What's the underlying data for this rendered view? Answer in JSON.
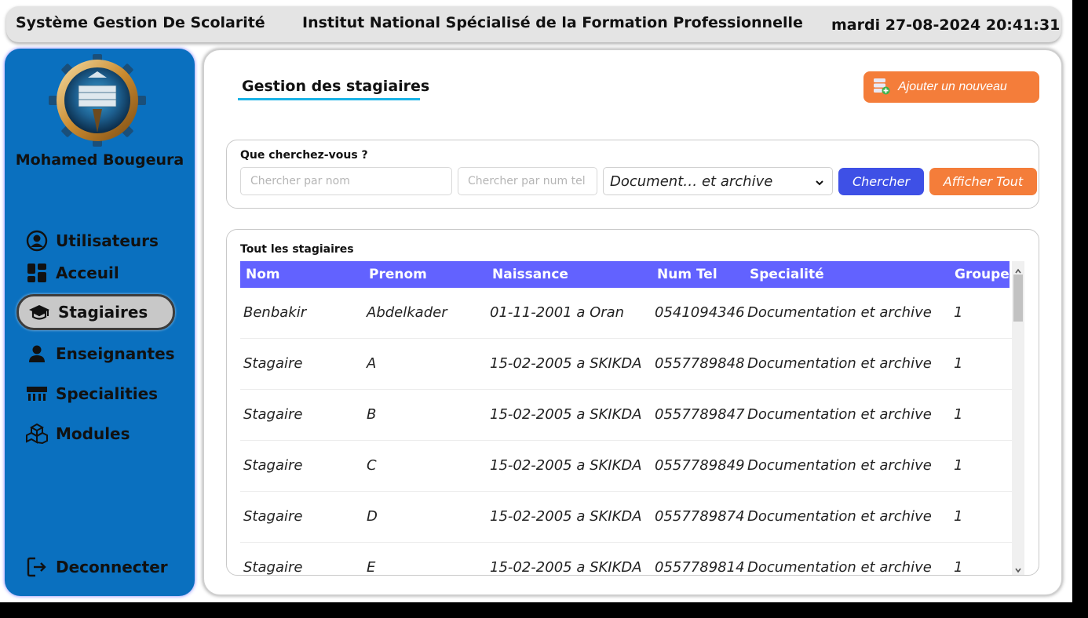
{
  "header": {
    "app_title": "Système Gestion De Scolarité",
    "institution": "Institut National Spécialisé de la Formation Professionnelle",
    "datetime": "mardi 27-08-2024 20:41:31"
  },
  "sidebar": {
    "username": "Mohamed Bougeura",
    "items": [
      {
        "label": "Utilisateurs",
        "icon": "user-circle-icon"
      },
      {
        "label": "Acceuil",
        "icon": "dashboard-icon"
      },
      {
        "label": "Stagiaires",
        "icon": "graduation-cap-icon",
        "active": true
      },
      {
        "label": "Enseignantes",
        "icon": "person-icon"
      },
      {
        "label": "Specialities",
        "icon": "classroom-icon"
      },
      {
        "label": "Modules",
        "icon": "cubes-icon"
      }
    ],
    "logout": {
      "label": "Deconnecter",
      "icon": "logout-icon"
    }
  },
  "main": {
    "title": "Gestion des stagiaires",
    "add_button": "Ajouter un nouveau",
    "search": {
      "label": "Que cherchez-vous ?",
      "name_placeholder": "Chercher par nom",
      "tel_placeholder": "Chercher par num tel",
      "specialty_selected": "Document… et archive",
      "search_button": "Chercher",
      "show_all_button": "Afficher Tout"
    },
    "table": {
      "label": "Tout les stagiaires",
      "columns": [
        "Nom",
        "Prenom",
        "Naissance",
        "Num Tel",
        "Specialité",
        "Groupe"
      ],
      "rows": [
        [
          "Benbakir",
          "Abdelkader",
          "01-11-2001 a Oran",
          "0541094346",
          "Documentation et archive",
          "1"
        ],
        [
          "Stagaire",
          "A",
          "15-02-2005 a SKIKDA",
          "0557789848",
          "Documentation et archive",
          "1"
        ],
        [
          "Stagaire",
          "B",
          "15-02-2005 a SKIKDA",
          "0557789847",
          "Documentation et archive",
          "1"
        ],
        [
          "Stagaire",
          "C",
          "15-02-2005 a SKIKDA",
          "0557789849",
          "Documentation et archive",
          "1"
        ],
        [
          "Stagaire",
          "D",
          "15-02-2005 a SKIKDA",
          "0557789874",
          "Documentation et archive",
          "1"
        ],
        [
          "Stagaire",
          "E",
          "15-02-2005 a SKIKDA",
          "0557789814",
          "Documentation et archive",
          "1"
        ]
      ]
    }
  },
  "colors": {
    "sidebar_bg": "#0a70bf",
    "accent_orange": "#f47d3a",
    "accent_blue": "#3e50e6",
    "table_header": "#6262ff",
    "title_underline": "#19b2e6"
  }
}
